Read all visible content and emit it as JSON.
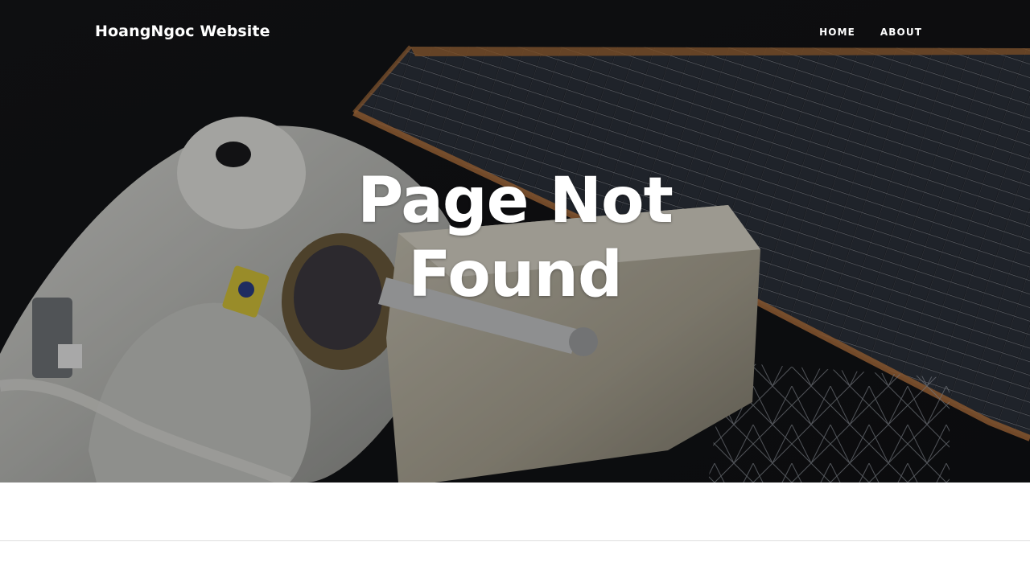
{
  "site": {
    "brand": "HoangNgoc Website"
  },
  "nav": {
    "items": [
      {
        "label": "HOME"
      },
      {
        "label": "ABOUT"
      }
    ]
  },
  "hero": {
    "heading": "Page Not Found",
    "background_image": "astronaut-spacewalk-solar-array",
    "overlay_color": "#000000"
  },
  "colors": {
    "nav_text": "#ffffff",
    "heading_text": "#ffffff",
    "page_background": "#ffffff",
    "divider": "#dedede"
  }
}
